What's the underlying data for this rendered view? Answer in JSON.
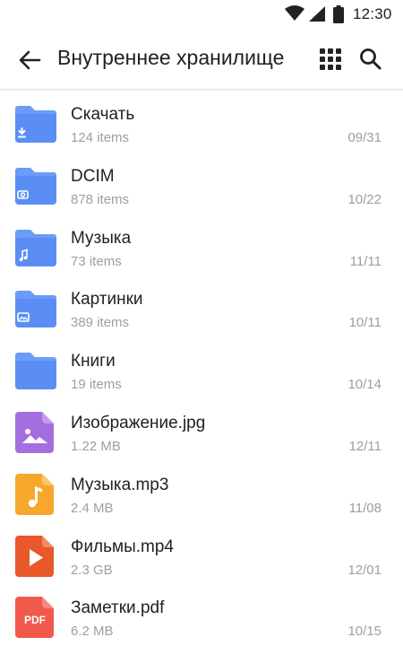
{
  "status_bar": {
    "time": "12:30",
    "icons": [
      "wifi-icon",
      "signal-icon",
      "battery-icon"
    ]
  },
  "app_bar": {
    "title": "Внутреннее хранилище",
    "back_icon": "arrow-back-icon",
    "view_icon": "grid-view-icon",
    "search_icon": "search-icon"
  },
  "colors": {
    "folder": "#6b9cf7",
    "folder_tab": "#4f84f0",
    "image": "#a36fe0",
    "audio": "#f7a82c",
    "video": "#e8582b",
    "pdf": "#ef5a4c"
  },
  "files": [
    {
      "name": "Скачать",
      "meta": "124 items",
      "date": "09/31",
      "icon": "folder-download-icon"
    },
    {
      "name": "DCIM",
      "meta": "878 items",
      "date": "10/22",
      "icon": "folder-camera-icon"
    },
    {
      "name": "Музыка",
      "meta": "73 items",
      "date": "11/11",
      "icon": "folder-music-icon"
    },
    {
      "name": "Картинки",
      "meta": "389 items",
      "date": "10/11",
      "icon": "folder-image-icon"
    },
    {
      "name": "Книги",
      "meta": "19 items",
      "date": "10/14",
      "icon": "folder-icon"
    },
    {
      "name": "Изображение.jpg",
      "meta": "1.22 MB",
      "date": "12/11",
      "icon": "image-file-icon"
    },
    {
      "name": "Музыка.mp3",
      "meta": "2.4 MB",
      "date": "11/08",
      "icon": "audio-file-icon"
    },
    {
      "name": "Фильмы.mp4",
      "meta": "2.3 GB",
      "date": "12/01",
      "icon": "video-file-icon"
    },
    {
      "name": "Заметки.pdf",
      "meta": "6.2 MB",
      "date": "10/15",
      "icon": "pdf-file-icon",
      "badge": "PDF"
    }
  ]
}
